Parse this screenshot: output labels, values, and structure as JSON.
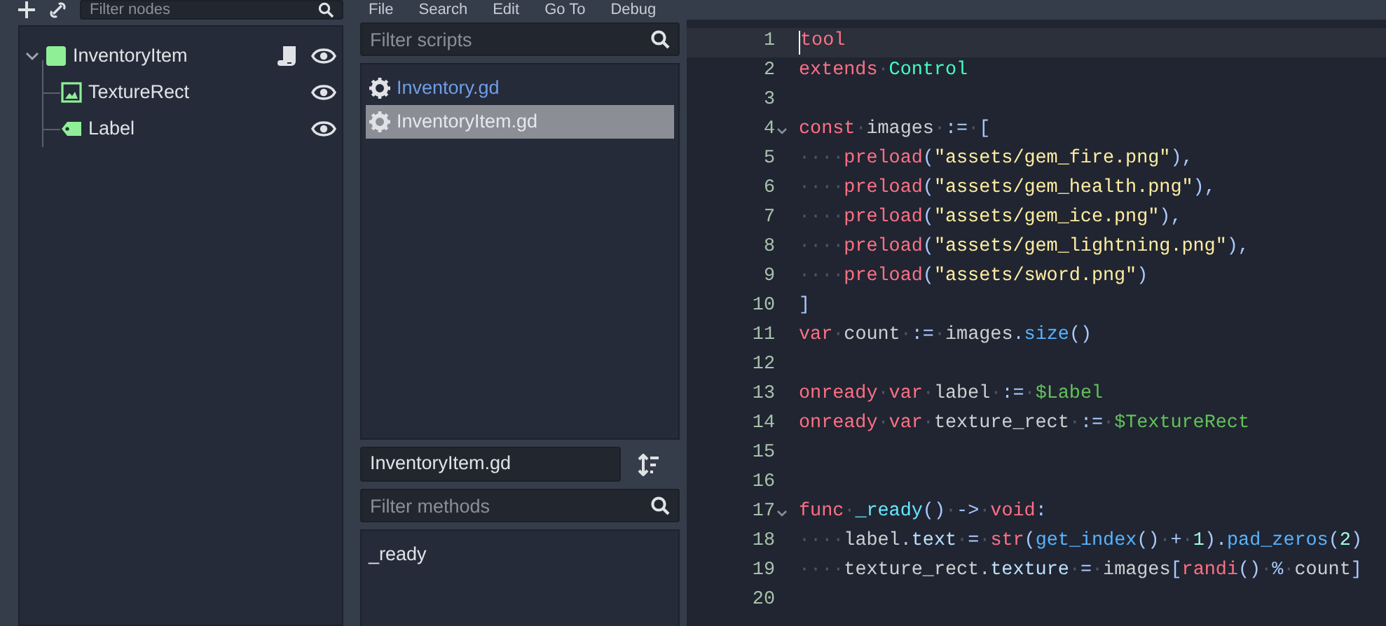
{
  "menu_bar": {
    "items": [
      "File",
      "Search",
      "Edit",
      "Go To",
      "Debug"
    ]
  },
  "scene_dock": {
    "filter": {
      "placeholder": "Filter nodes"
    },
    "tree": [
      {
        "label": "InventoryItem",
        "kind": "control",
        "expanded": true,
        "has_script": true,
        "visible": true,
        "children": [
          {
            "label": "TextureRect",
            "kind": "texture_rect",
            "has_script": false,
            "visible": true
          },
          {
            "label": "Label",
            "kind": "label",
            "has_script": false,
            "visible": true
          }
        ]
      }
    ]
  },
  "script_panel": {
    "filter": {
      "placeholder": "Filter scripts"
    },
    "scripts": [
      {
        "name": "Inventory.gd",
        "selected": false,
        "color": "#6f9de8"
      },
      {
        "name": "InventoryItem.gd",
        "selected": true,
        "color": "#e6e8ec"
      }
    ],
    "current_script": "InventoryItem.gd",
    "methods_filter": {
      "placeholder": "Filter methods"
    },
    "methods": [
      "_ready"
    ]
  },
  "editor": {
    "lines": [
      {
        "number": "1",
        "current": true,
        "foldable": false,
        "tokens": [
          {
            "kind": "kw",
            "text": "tool"
          }
        ]
      },
      {
        "number": "2",
        "current": false,
        "foldable": false,
        "tokens": [
          {
            "kind": "kw",
            "text": "extends"
          },
          {
            "kind": "ws",
            "text": "·"
          },
          {
            "kind": "type",
            "text": "Control"
          }
        ]
      },
      {
        "number": "3",
        "current": false,
        "foldable": false
      },
      {
        "number": "4",
        "current": false,
        "foldable": true,
        "tokens": [
          {
            "kind": "kw",
            "text": "const"
          },
          {
            "kind": "ws",
            "text": "·"
          },
          {
            "kind": "id",
            "text": "images"
          },
          {
            "kind": "ws",
            "text": "·"
          },
          {
            "kind": "sym",
            "text": ":="
          },
          {
            "kind": "ws",
            "text": "·"
          },
          {
            "kind": "sym",
            "text": "["
          }
        ]
      },
      {
        "number": "5",
        "current": false,
        "foldable": false,
        "tokens": [
          {
            "kind": "ws",
            "text": "····"
          },
          {
            "kind": "kw",
            "text": "preload"
          },
          {
            "kind": "sym",
            "text": "("
          },
          {
            "kind": "str",
            "text": "\"assets/gem_fire.png\""
          },
          {
            "kind": "sym",
            "text": "),"
          }
        ]
      },
      {
        "number": "6",
        "current": false,
        "foldable": false,
        "tokens": [
          {
            "kind": "ws",
            "text": "····"
          },
          {
            "kind": "kw",
            "text": "preload"
          },
          {
            "kind": "sym",
            "text": "("
          },
          {
            "kind": "str",
            "text": "\"assets/gem_health.png\""
          },
          {
            "kind": "sym",
            "text": "),"
          }
        ]
      },
      {
        "number": "7",
        "current": false,
        "foldable": false,
        "tokens": [
          {
            "kind": "ws",
            "text": "····"
          },
          {
            "kind": "kw",
            "text": "preload"
          },
          {
            "kind": "sym",
            "text": "("
          },
          {
            "kind": "str",
            "text": "\"assets/gem_ice.png\""
          },
          {
            "kind": "sym",
            "text": "),"
          }
        ]
      },
      {
        "number": "8",
        "current": false,
        "foldable": false,
        "tokens": [
          {
            "kind": "ws",
            "text": "····"
          },
          {
            "kind": "kw",
            "text": "preload"
          },
          {
            "kind": "sym",
            "text": "("
          },
          {
            "kind": "str",
            "text": "\"assets/gem_lightning.png\""
          },
          {
            "kind": "sym",
            "text": "),"
          }
        ]
      },
      {
        "number": "9",
        "current": false,
        "foldable": false,
        "tokens": [
          {
            "kind": "ws",
            "text": "····"
          },
          {
            "kind": "kw",
            "text": "preload"
          },
          {
            "kind": "sym",
            "text": "("
          },
          {
            "kind": "str",
            "text": "\"assets/sword.png\""
          },
          {
            "kind": "sym",
            "text": ")"
          }
        ]
      },
      {
        "number": "10",
        "current": false,
        "foldable": false,
        "tokens": [
          {
            "kind": "sym",
            "text": "]"
          }
        ]
      },
      {
        "number": "11",
        "current": false,
        "foldable": false,
        "tokens": [
          {
            "kind": "kw",
            "text": "var"
          },
          {
            "kind": "ws",
            "text": "·"
          },
          {
            "kind": "id",
            "text": "count"
          },
          {
            "kind": "ws",
            "text": "·"
          },
          {
            "kind": "sym",
            "text": ":="
          },
          {
            "kind": "ws",
            "text": "·"
          },
          {
            "kind": "id",
            "text": "images"
          },
          {
            "kind": "sym",
            "text": "."
          },
          {
            "kind": "fn",
            "text": "size"
          },
          {
            "kind": "sym",
            "text": "()"
          }
        ]
      },
      {
        "number": "12",
        "current": false,
        "foldable": false
      },
      {
        "number": "13",
        "current": false,
        "foldable": false,
        "tokens": [
          {
            "kind": "kw",
            "text": "onready"
          },
          {
            "kind": "ws",
            "text": "·"
          },
          {
            "kind": "kw",
            "text": "var"
          },
          {
            "kind": "ws",
            "text": "·"
          },
          {
            "kind": "id",
            "text": "label"
          },
          {
            "kind": "ws",
            "text": "·"
          },
          {
            "kind": "sym",
            "text": ":="
          },
          {
            "kind": "ws",
            "text": "·"
          },
          {
            "kind": "node",
            "text": "$Label"
          }
        ]
      },
      {
        "number": "14",
        "current": false,
        "foldable": false,
        "tokens": [
          {
            "kind": "kw",
            "text": "onready"
          },
          {
            "kind": "ws",
            "text": "·"
          },
          {
            "kind": "kw",
            "text": "var"
          },
          {
            "kind": "ws",
            "text": "·"
          },
          {
            "kind": "id",
            "text": "texture_rect"
          },
          {
            "kind": "ws",
            "text": "·"
          },
          {
            "kind": "sym",
            "text": ":="
          },
          {
            "kind": "ws",
            "text": "·"
          },
          {
            "kind": "node",
            "text": "$TextureRect"
          }
        ]
      },
      {
        "number": "15",
        "current": false,
        "foldable": false
      },
      {
        "number": "16",
        "current": false,
        "foldable": false
      },
      {
        "number": "17",
        "current": false,
        "foldable": true,
        "tokens": [
          {
            "kind": "kw",
            "text": "func"
          },
          {
            "kind": "ws",
            "text": "·"
          },
          {
            "kind": "fndef",
            "text": "_ready"
          },
          {
            "kind": "sym",
            "text": "()"
          },
          {
            "kind": "ws",
            "text": "·"
          },
          {
            "kind": "sym",
            "text": "->"
          },
          {
            "kind": "ws",
            "text": "·"
          },
          {
            "kind": "kw",
            "text": "void"
          },
          {
            "kind": "sym",
            "text": ":"
          }
        ]
      },
      {
        "number": "18",
        "current": false,
        "foldable": false,
        "tokens": [
          {
            "kind": "ws",
            "text": "····"
          },
          {
            "kind": "id",
            "text": "label"
          },
          {
            "kind": "sym",
            "text": "."
          },
          {
            "kind": "mem",
            "text": "text"
          },
          {
            "kind": "ws",
            "text": "·"
          },
          {
            "kind": "sym",
            "text": "="
          },
          {
            "kind": "ws",
            "text": "·"
          },
          {
            "kind": "kw",
            "text": "str"
          },
          {
            "kind": "sym",
            "text": "("
          },
          {
            "kind": "fn",
            "text": "get_index"
          },
          {
            "kind": "sym",
            "text": "()"
          },
          {
            "kind": "ws",
            "text": "·"
          },
          {
            "kind": "sym",
            "text": "+"
          },
          {
            "kind": "ws",
            "text": "·"
          },
          {
            "kind": "num",
            "text": "1"
          },
          {
            "kind": "sym",
            "text": ")."
          },
          {
            "kind": "fn",
            "text": "pad_zeros"
          },
          {
            "kind": "sym",
            "text": "("
          },
          {
            "kind": "num",
            "text": "2"
          },
          {
            "kind": "sym",
            "text": ")"
          }
        ]
      },
      {
        "number": "19",
        "current": false,
        "foldable": false,
        "tokens": [
          {
            "kind": "ws",
            "text": "····"
          },
          {
            "kind": "id",
            "text": "texture_rect"
          },
          {
            "kind": "sym",
            "text": "."
          },
          {
            "kind": "mem",
            "text": "texture"
          },
          {
            "kind": "ws",
            "text": "·"
          },
          {
            "kind": "sym",
            "text": "="
          },
          {
            "kind": "ws",
            "text": "·"
          },
          {
            "kind": "id",
            "text": "images"
          },
          {
            "kind": "sym",
            "text": "["
          },
          {
            "kind": "kw",
            "text": "randi"
          },
          {
            "kind": "sym",
            "text": "()"
          },
          {
            "kind": "ws",
            "text": "·"
          },
          {
            "kind": "sym",
            "text": "%"
          },
          {
            "kind": "ws",
            "text": "·"
          },
          {
            "kind": "id",
            "text": "count"
          },
          {
            "kind": "sym",
            "text": "]"
          }
        ]
      },
      {
        "number": "20",
        "current": false,
        "foldable": false
      }
    ]
  }
}
